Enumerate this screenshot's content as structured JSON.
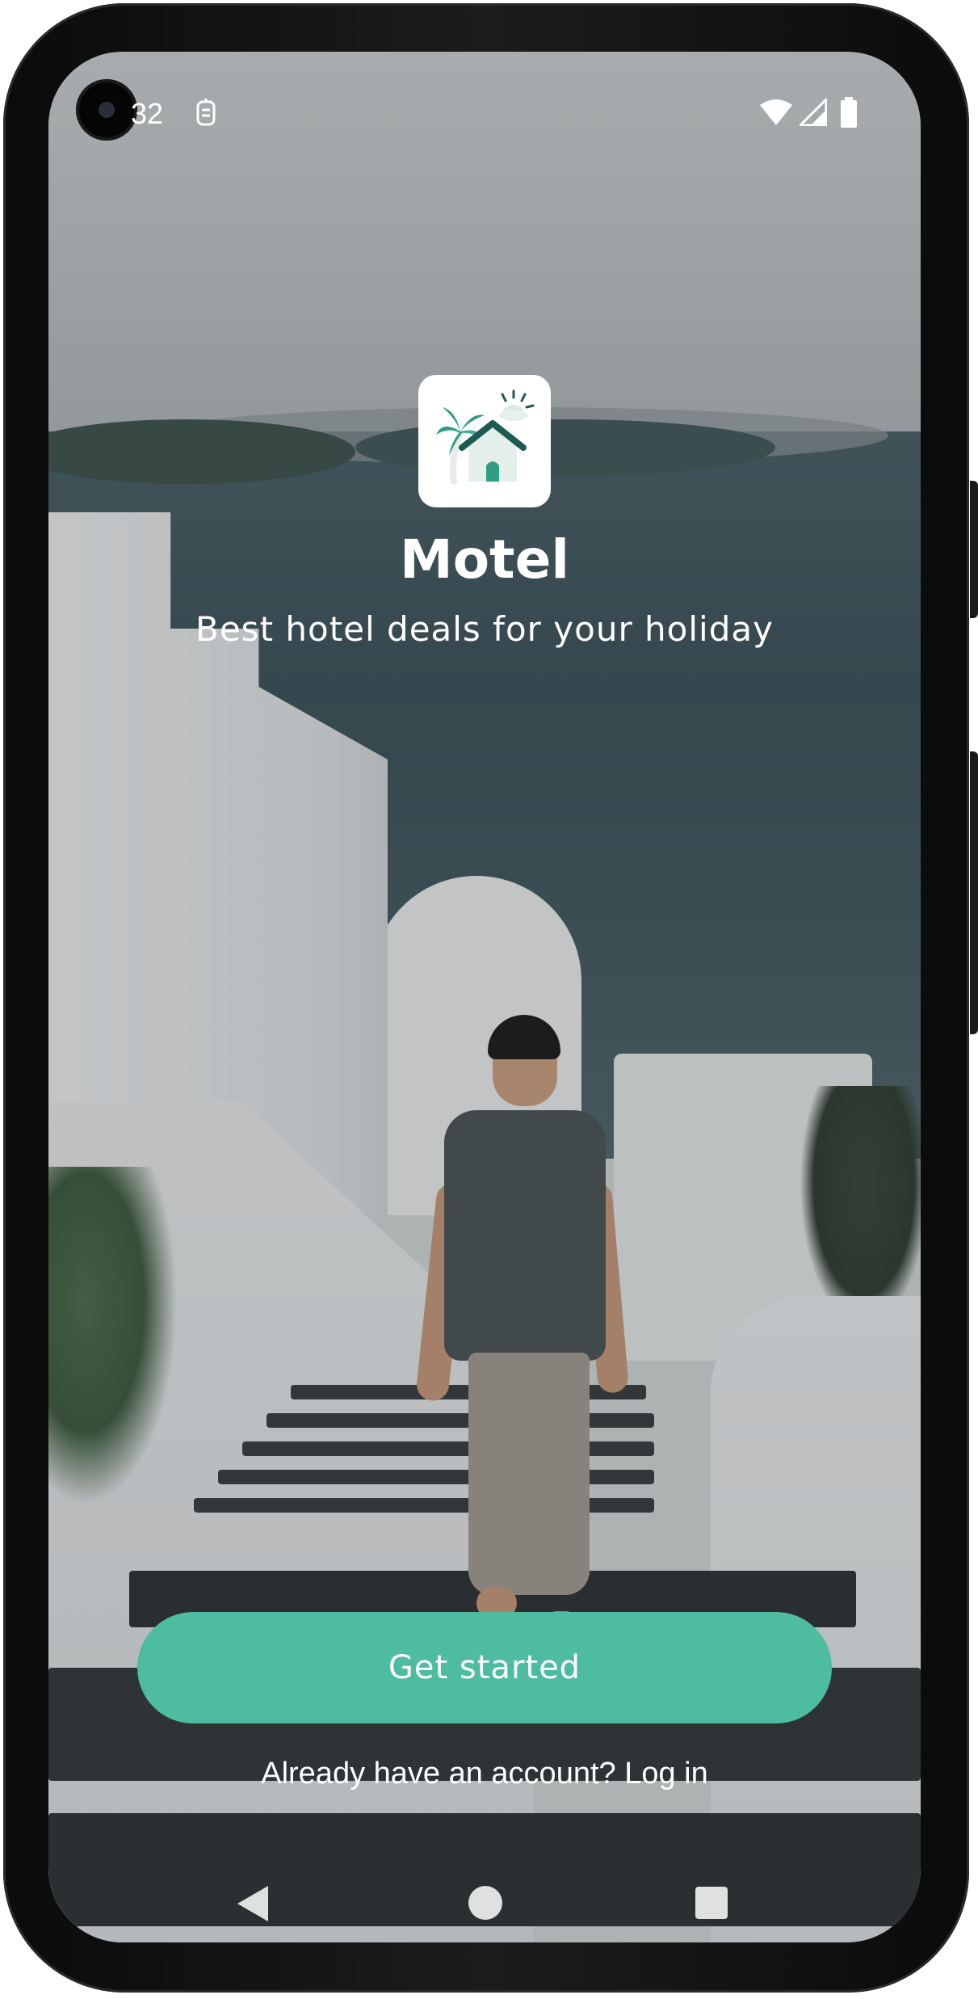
{
  "status_bar": {
    "time": "32",
    "icons": [
      "notification-icon",
      "wifi-icon",
      "cell-signal-icon",
      "battery-icon"
    ]
  },
  "app": {
    "name": "Motel",
    "tagline": "Best hotel deals for your holiday",
    "logo_icon": "palm-house-logo-icon"
  },
  "actions": {
    "get_started_label": "Get started",
    "login_label": "Already have an account? Log in"
  },
  "navigation": {
    "buttons": [
      "back-icon",
      "home-icon",
      "recents-icon"
    ]
  },
  "colors": {
    "accent": "#4dbca0",
    "logo_teal": "#2f9e82",
    "logo_dark": "#1d5a52"
  }
}
